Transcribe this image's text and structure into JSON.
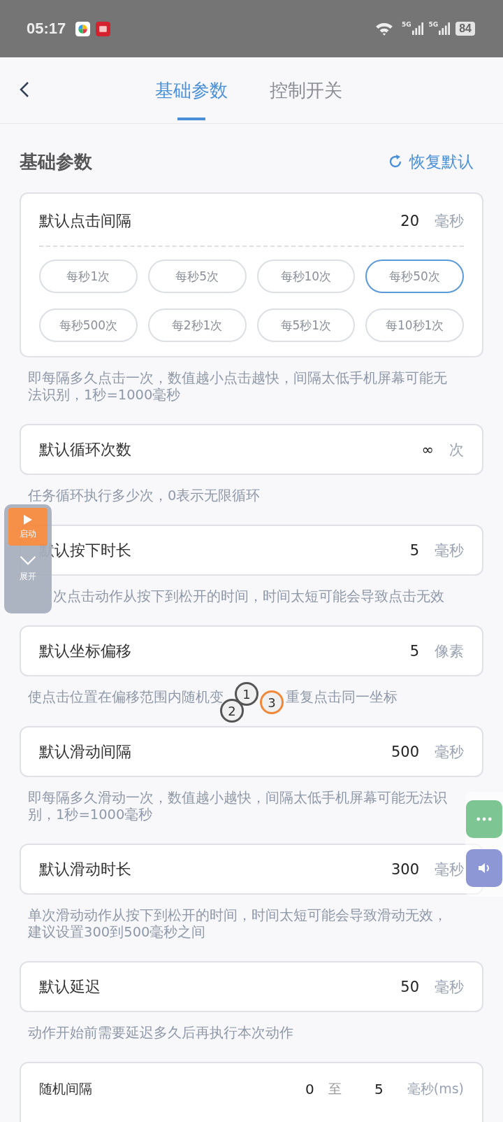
{
  "status_bar": {
    "time": "05:17",
    "signals": [
      "5G",
      "5G"
    ],
    "battery": "84"
  },
  "header": {
    "tabs": [
      {
        "label": "基础参数",
        "selected": true
      },
      {
        "label": "控制开关",
        "selected": false
      }
    ]
  },
  "section": {
    "title": "基础参数",
    "reset_button": "恢复默认"
  },
  "settings": [
    {
      "kind": "chips",
      "label": "默认点击间隔",
      "value": "20",
      "unit": "毫秒",
      "chips": [
        {
          "label": "每秒1次",
          "selected": false
        },
        {
          "label": "每秒5次",
          "selected": false
        },
        {
          "label": "每秒10次",
          "selected": false
        },
        {
          "label": "每秒50次",
          "selected": true
        },
        {
          "label": "每秒500次",
          "selected": false
        },
        {
          "label": "每2秒1次",
          "selected": false
        },
        {
          "label": "每5秒1次",
          "selected": false
        },
        {
          "label": "每10秒1次",
          "selected": false
        }
      ],
      "hint": "即每隔多久点击一次，数值越小点击越快，间隔太低手机屏幕可能无法识别，1秒=1000毫秒"
    },
    {
      "kind": "value",
      "label": "默认循环次数",
      "value": "∞",
      "unit": "次",
      "hint": "任务循环执行多少次，0表示无限循环"
    },
    {
      "kind": "value",
      "label": "默认按下时长",
      "value": "5",
      "unit": "毫秒",
      "hint": "次点击动作从按下到松开的时间，时间太短可能会导致点击无效",
      "hint_covered": true
    },
    {
      "kind": "value",
      "label": "默认坐标偏移",
      "value": "5",
      "unit": "像素",
      "hint_parts": [
        "使点击位置在偏移范围内随机变",
        "重复点击同一坐标"
      ]
    },
    {
      "kind": "value",
      "label": "默认滑动间隔",
      "value": "500",
      "unit": "毫秒",
      "hint": "即每隔多久滑动一次，数值越小越快，间隔太低手机屏幕可能无法识别，1秒=1000毫秒"
    },
    {
      "kind": "value",
      "label": "默认滑动时长",
      "value": "300",
      "unit": "毫秒",
      "hint": "单次滑动动作从按下到松开的时间，时间太短可能会导致滑动无效，建议设置300到500毫秒之间"
    },
    {
      "kind": "value",
      "label": "默认延迟",
      "value": "50",
      "unit": "毫秒",
      "hint": "动作开始前需要延迟多久后再执行本次动作"
    },
    {
      "kind": "range",
      "label": "随机间隔",
      "from": "0",
      "separator": "至",
      "to": "5",
      "unit": "毫秒(ms)"
    }
  ],
  "float_panel": {
    "start_label": "启动",
    "expand_label": "展开"
  },
  "markers": [
    {
      "label": "1",
      "color": "#555555"
    },
    {
      "label": "2",
      "color": "#555555"
    },
    {
      "label": "3",
      "color": "#f0883a"
    }
  ]
}
